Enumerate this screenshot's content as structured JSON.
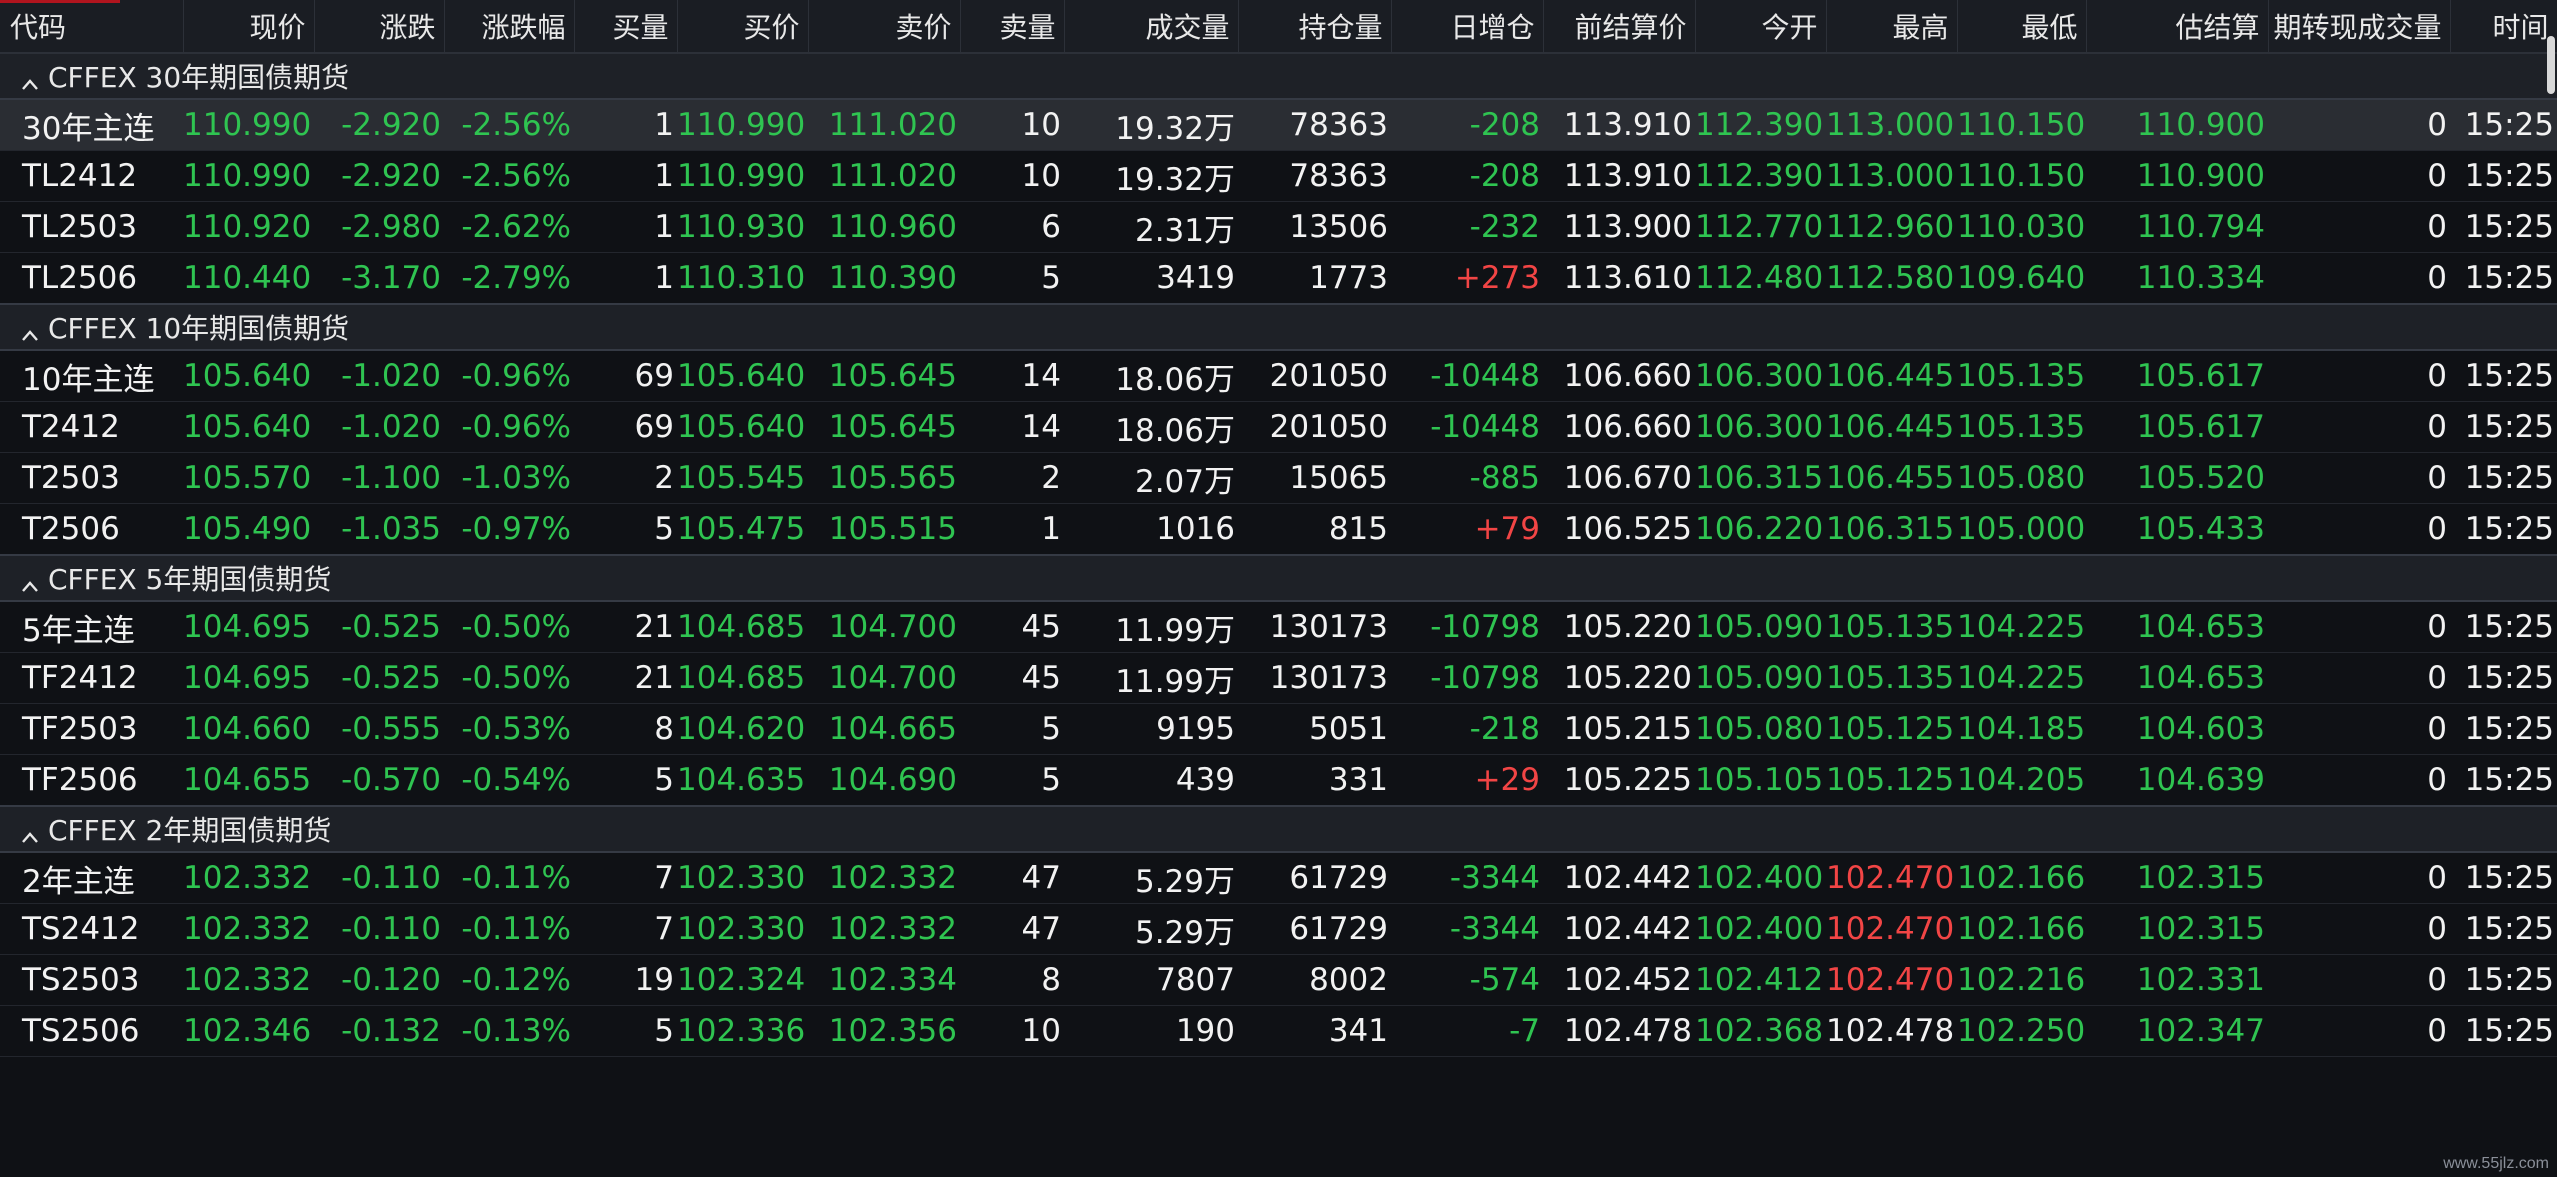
{
  "colors": {
    "up": "#f24545",
    "down": "#2fc451",
    "neutral": "#f2f2f2",
    "header_bg": "#1a1d23",
    "group_bg": "#1e2127"
  },
  "headers": [
    "代码",
    "现价",
    "涨跌",
    "涨跌幅",
    "买量",
    "买价",
    "卖价",
    "卖量",
    "成交量",
    "持仓量",
    "日增仓",
    "前结算价",
    "今开",
    "最高",
    "最低",
    "估结算",
    "期转现成交量",
    "时间"
  ],
  "groups": [
    {
      "title": "CFFEX 30年期国债期货",
      "rows": [
        {
          "cells": [
            "30年主连",
            "110.990",
            "-2.920",
            "-2.56%",
            "1",
            "110.990",
            "111.020",
            "10",
            "19.32万",
            "78363",
            "-208",
            "113.910",
            "112.390",
            "113.000",
            "110.150",
            "110.900",
            "0",
            "15:25"
          ],
          "dayoi": "down",
          "high": "down"
        },
        {
          "cells": [
            "TL2412",
            "110.990",
            "-2.920",
            "-2.56%",
            "1",
            "110.990",
            "111.020",
            "10",
            "19.32万",
            "78363",
            "-208",
            "113.910",
            "112.390",
            "113.000",
            "110.150",
            "110.900",
            "0",
            "15:25"
          ],
          "dayoi": "down",
          "high": "down"
        },
        {
          "cells": [
            "TL2503",
            "110.920",
            "-2.980",
            "-2.62%",
            "1",
            "110.930",
            "110.960",
            "6",
            "2.31万",
            "13506",
            "-232",
            "113.900",
            "112.770",
            "112.960",
            "110.030",
            "110.794",
            "0",
            "15:25"
          ],
          "dayoi": "down",
          "high": "down"
        },
        {
          "cells": [
            "TL2506",
            "110.440",
            "-3.170",
            "-2.79%",
            "1",
            "110.310",
            "110.390",
            "5",
            "3419",
            "1773",
            "+273",
            "113.610",
            "112.480",
            "112.580",
            "109.640",
            "110.334",
            "0",
            "15:25"
          ],
          "dayoi": "up",
          "high": "down"
        }
      ]
    },
    {
      "title": "CFFEX 10年期国债期货",
      "rows": [
        {
          "cells": [
            "10年主连",
            "105.640",
            "-1.020",
            "-0.96%",
            "69",
            "105.640",
            "105.645",
            "14",
            "18.06万",
            "201050",
            "-10448",
            "106.660",
            "106.300",
            "106.445",
            "105.135",
            "105.617",
            "0",
            "15:25"
          ],
          "dayoi": "down",
          "high": "down"
        },
        {
          "cells": [
            "T2412",
            "105.640",
            "-1.020",
            "-0.96%",
            "69",
            "105.640",
            "105.645",
            "14",
            "18.06万",
            "201050",
            "-10448",
            "106.660",
            "106.300",
            "106.445",
            "105.135",
            "105.617",
            "0",
            "15:25"
          ],
          "dayoi": "down",
          "high": "down"
        },
        {
          "cells": [
            "T2503",
            "105.570",
            "-1.100",
            "-1.03%",
            "2",
            "105.545",
            "105.565",
            "2",
            "2.07万",
            "15065",
            "-885",
            "106.670",
            "106.315",
            "106.455",
            "105.080",
            "105.520",
            "0",
            "15:25"
          ],
          "dayoi": "down",
          "high": "down"
        },
        {
          "cells": [
            "T2506",
            "105.490",
            "-1.035",
            "-0.97%",
            "5",
            "105.475",
            "105.515",
            "1",
            "1016",
            "815",
            "+79",
            "106.525",
            "106.220",
            "106.315",
            "105.000",
            "105.433",
            "0",
            "15:25"
          ],
          "dayoi": "up",
          "high": "down"
        }
      ]
    },
    {
      "title": "CFFEX 5年期国债期货",
      "rows": [
        {
          "cells": [
            "5年主连",
            "104.695",
            "-0.525",
            "-0.50%",
            "21",
            "104.685",
            "104.700",
            "45",
            "11.99万",
            "130173",
            "-10798",
            "105.220",
            "105.090",
            "105.135",
            "104.225",
            "104.653",
            "0",
            "15:25"
          ],
          "dayoi": "down",
          "high": "down"
        },
        {
          "cells": [
            "TF2412",
            "104.695",
            "-0.525",
            "-0.50%",
            "21",
            "104.685",
            "104.700",
            "45",
            "11.99万",
            "130173",
            "-10798",
            "105.220",
            "105.090",
            "105.135",
            "104.225",
            "104.653",
            "0",
            "15:25"
          ],
          "dayoi": "down",
          "high": "down"
        },
        {
          "cells": [
            "TF2503",
            "104.660",
            "-0.555",
            "-0.53%",
            "8",
            "104.620",
            "104.665",
            "5",
            "9195",
            "5051",
            "-218",
            "105.215",
            "105.080",
            "105.125",
            "104.185",
            "104.603",
            "0",
            "15:25"
          ],
          "dayoi": "down",
          "high": "down"
        },
        {
          "cells": [
            "TF2506",
            "104.655",
            "-0.570",
            "-0.54%",
            "5",
            "104.635",
            "104.690",
            "5",
            "439",
            "331",
            "+29",
            "105.225",
            "105.105",
            "105.125",
            "104.205",
            "104.639",
            "0",
            "15:25"
          ],
          "dayoi": "up",
          "high": "down"
        }
      ]
    },
    {
      "title": "CFFEX 2年期国债期货",
      "rows": [
        {
          "cells": [
            "2年主连",
            "102.332",
            "-0.110",
            "-0.11%",
            "7",
            "102.330",
            "102.332",
            "47",
            "5.29万",
            "61729",
            "-3344",
            "102.442",
            "102.400",
            "102.470",
            "102.166",
            "102.315",
            "0",
            "15:25"
          ],
          "dayoi": "down",
          "high": "up"
        },
        {
          "cells": [
            "TS2412",
            "102.332",
            "-0.110",
            "-0.11%",
            "7",
            "102.330",
            "102.332",
            "47",
            "5.29万",
            "61729",
            "-3344",
            "102.442",
            "102.400",
            "102.470",
            "102.166",
            "102.315",
            "0",
            "15:25"
          ],
          "dayoi": "down",
          "high": "up"
        },
        {
          "cells": [
            "TS2503",
            "102.332",
            "-0.120",
            "-0.12%",
            "19",
            "102.324",
            "102.334",
            "8",
            "7807",
            "8002",
            "-574",
            "102.452",
            "102.412",
            "102.470",
            "102.216",
            "102.331",
            "0",
            "15:25"
          ],
          "dayoi": "down",
          "high": "up"
        },
        {
          "cells": [
            "TS2506",
            "102.346",
            "-0.132",
            "-0.13%",
            "5",
            "102.336",
            "102.356",
            "10",
            "190",
            "341",
            "-7",
            "102.478",
            "102.368",
            "102.478",
            "102.250",
            "102.347",
            "0",
            "15:25"
          ],
          "dayoi": "down",
          "high": "white"
        }
      ]
    }
  ],
  "watermark": "www.55jlz.com"
}
